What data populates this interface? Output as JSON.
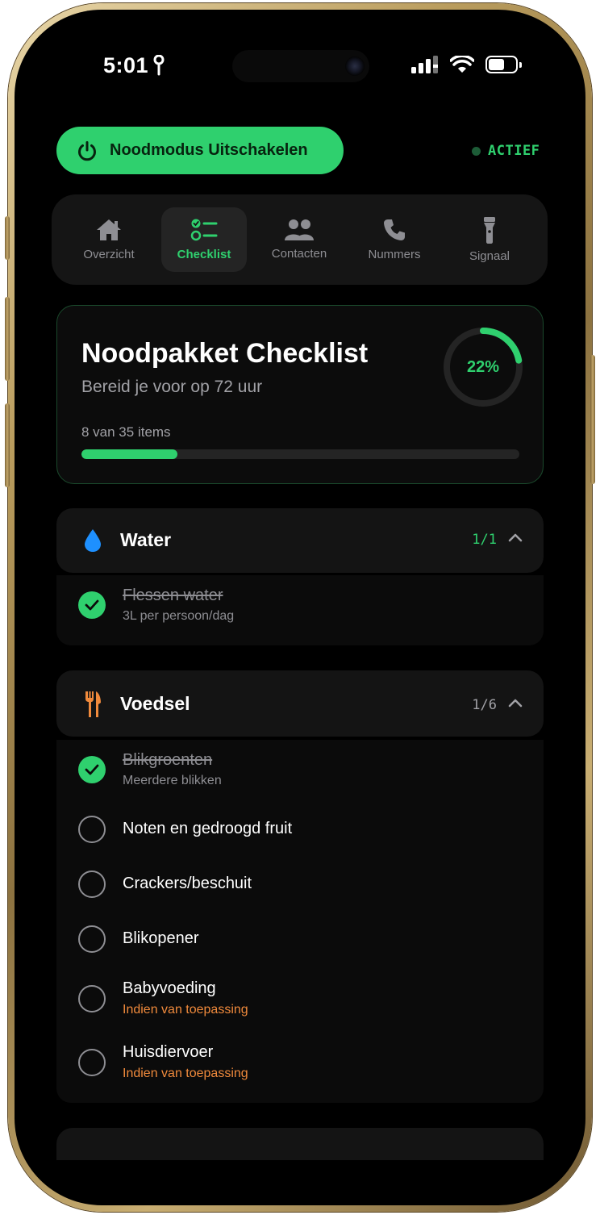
{
  "status_bar": {
    "time": "5:01"
  },
  "emergency": {
    "button_label": "Noodmodus Uitschakelen",
    "status_label": "ACTIEF"
  },
  "tabs": [
    {
      "label": "Overzicht",
      "icon": "house-icon",
      "active": false
    },
    {
      "label": "Checklist",
      "icon": "checklist-icon",
      "active": true
    },
    {
      "label": "Contacten",
      "icon": "people-icon",
      "active": false
    },
    {
      "label": "Nummers",
      "icon": "phone-icon",
      "active": false
    },
    {
      "label": "Signaal",
      "icon": "flashlight-icon",
      "active": false
    }
  ],
  "progress_card": {
    "title": "Noodpakket Checklist",
    "subtitle": "Bereid je voor op 72 uur",
    "count_label": "8 van 35 items",
    "percent_label": "22%",
    "progress_fraction": 0.22
  },
  "sections": [
    {
      "title": "Water",
      "icon": "water-drop-icon",
      "count": "1/1",
      "count_color": "#2fd06e",
      "expanded": true,
      "items": [
        {
          "title": "Flessen water",
          "subtitle": "3L per persoon/dag",
          "checked": true
        }
      ]
    },
    {
      "title": "Voedsel",
      "icon": "fork-knife-icon",
      "count": "1/6",
      "count_color": "#a1a1a6",
      "expanded": true,
      "items": [
        {
          "title": "Blikgroenten",
          "subtitle": "Meerdere blikken",
          "checked": true
        },
        {
          "title": "Noten en gedroogd fruit",
          "checked": false
        },
        {
          "title": "Crackers/beschuit",
          "checked": false
        },
        {
          "title": "Blikopener",
          "checked": false
        },
        {
          "title": "Babyvoeding",
          "subtitle": "Indien van toepassing",
          "checked": false,
          "subtitle_color": "#f08a3c"
        },
        {
          "title": "Huisdiervoer",
          "subtitle": "Indien van toepassing",
          "checked": false,
          "subtitle_color": "#f08a3c"
        }
      ]
    }
  ],
  "colors": {
    "accent": "#2fd06e",
    "warning": "#f08a3c",
    "water": "#1e90ff",
    "food": "#f08a3c"
  }
}
